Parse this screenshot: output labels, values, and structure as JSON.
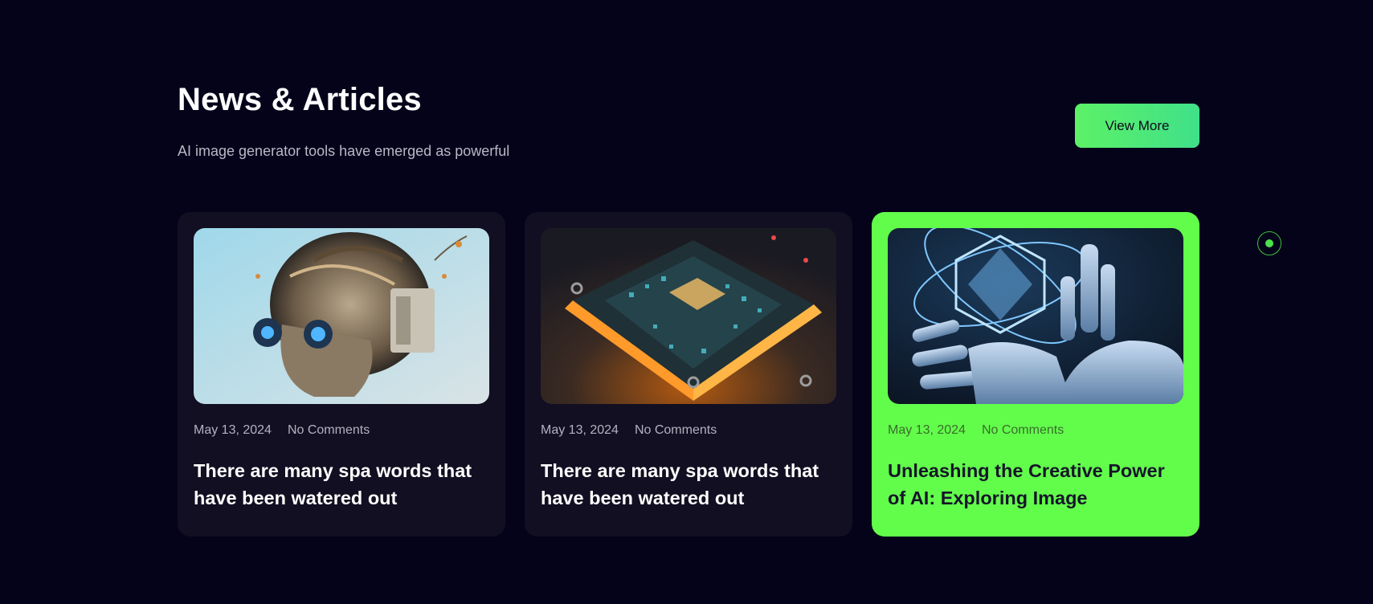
{
  "section": {
    "title": "News & Articles",
    "subtitle": "AI image generator tools have emerged as powerful",
    "view_more_label": "View More"
  },
  "cards": [
    {
      "image_icon": "robot-skull-image",
      "date": "May 13, 2024",
      "comments": "No Comments",
      "title": "There are many spa words that have been watered out",
      "active": false
    },
    {
      "image_icon": "circuit-chip-image",
      "date": "May 13, 2024",
      "comments": "No Comments",
      "title": "There are many spa words that have been watered out",
      "active": false
    },
    {
      "image_icon": "robot-hand-atom-image",
      "date": "May 13, 2024",
      "comments": "No Comments",
      "title": "Unleashing the Creative Power of AI: Exploring Image",
      "active": true
    }
  ],
  "colors": {
    "background": "#05031a",
    "card": "#110f21",
    "accent": "#62fd4b",
    "button_gradient_start": "#5cf167",
    "button_gradient_end": "#40e08a"
  }
}
